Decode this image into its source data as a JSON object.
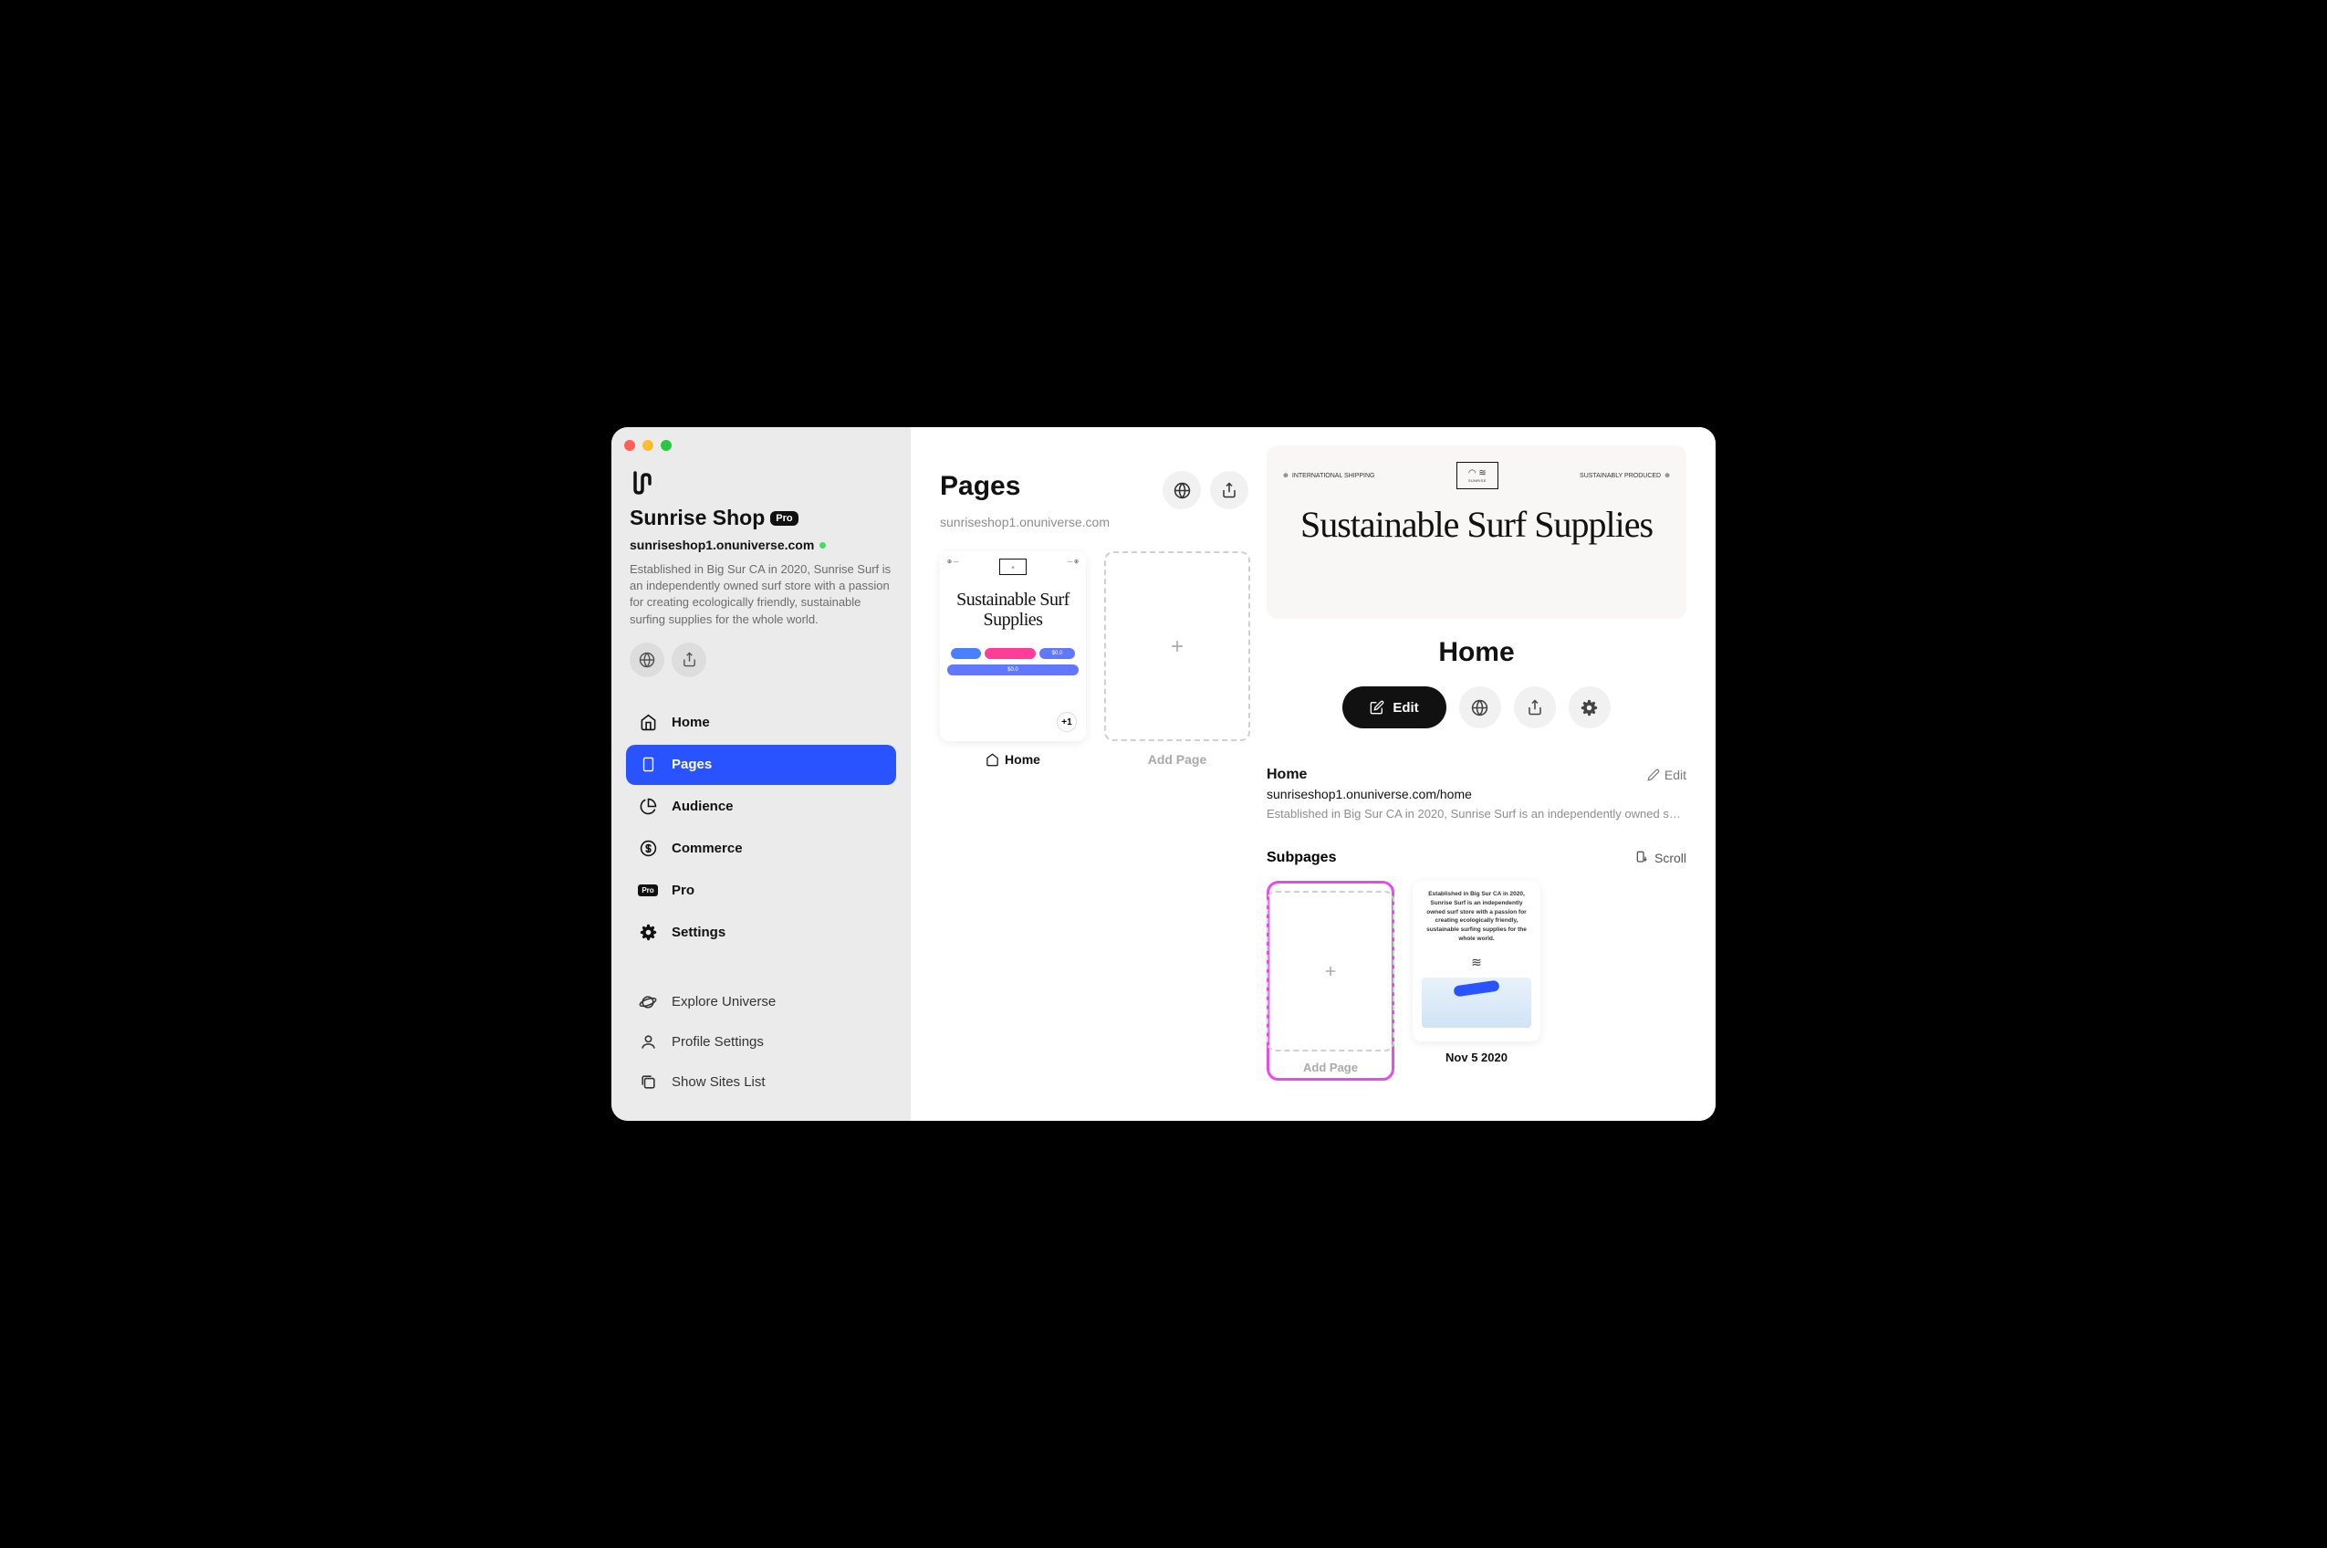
{
  "site": {
    "name": "Sunrise Shop",
    "badge": "Pro",
    "url": "sunriseshop1.onuniverse.com",
    "description": "Established in Big Sur CA in 2020, Sunrise Surf is an independently owned surf store with a passion for creating ecologically friendly, sustainable surfing supplies for the whole world."
  },
  "nav": {
    "home": "Home",
    "pages": "Pages",
    "audience": "Audience",
    "commerce": "Commerce",
    "pro": "Pro",
    "settings": "Settings",
    "explore": "Explore Universe",
    "profile": "Profile Settings",
    "sites": "Show Sites List"
  },
  "pages": {
    "title": "Pages",
    "subtitle": "sunriseshop1.onuniverse.com",
    "card1": {
      "label": "Home",
      "heroTitle": "Sustainable Surf Supplies",
      "price": "$0.0",
      "badge": "+1"
    },
    "addLabel": "Add Page"
  },
  "detail": {
    "heroTitle": "Sustainable Surf Supplies",
    "heroTopLeft": "INTERNATIONAL SHIPPING",
    "heroTopRight": "SUSTAINABLY PRODUCED",
    "title": "Home",
    "editBtn": "Edit",
    "metaTitle": "Home",
    "metaEdit": "Edit",
    "metaUrl": "sunriseshop1.onuniverse.com/home",
    "metaDesc": "Established in Big Sur CA in 2020, Sunrise Surf is an independently owned surf...",
    "subpagesTitle": "Subpages",
    "scrollLabel": "Scroll",
    "subAdd": "Add Page",
    "sub1": {
      "label": "Nov 5 2020",
      "desc": "Established in Big Sur CA in 2020, Sunrise Surf is an independently owned surf store with a passion for creating ecologically friendly, sustainable surfing supplies for the whole world."
    }
  }
}
